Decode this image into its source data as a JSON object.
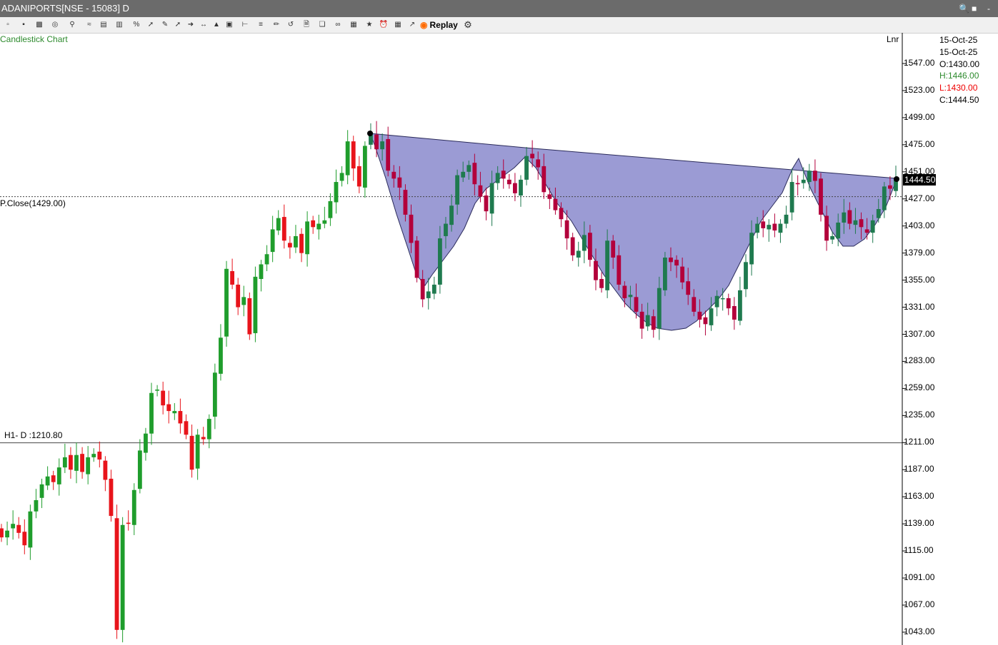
{
  "window": {
    "title": "ADANIPORTS[NSE - 15083] D",
    "controls": [
      "-"
    ]
  },
  "toolbar": {
    "replay_label": "Replay"
  },
  "chart": {
    "title": "Candlestick Chart",
    "scale_mode": "Lnr",
    "info": {
      "date1": "15-Oct-25",
      "date2": "15-Oct-25",
      "open": "O:1430.00",
      "high": "H:1446.00",
      "low": "L:1430.00",
      "close": "C:1444.50"
    },
    "prev_close_label": "P.Close(1429.00)",
    "h1_label": "H1- D :1210.80",
    "last_price_label": "1444.50",
    "colors": {
      "up": "#1f9d2c",
      "down": "#e8141b",
      "down_in_pattern": "#b3003b",
      "up_in_pattern": "#1f7a4f",
      "pattern_fill": "#9b9bd4",
      "axis": "#000000"
    }
  },
  "chart_data": {
    "type": "candlestick",
    "y_ticks": [
      1547,
      1523,
      1499,
      1475,
      1451,
      1427,
      1403,
      1379,
      1355,
      1331,
      1307,
      1283,
      1259,
      1235,
      1211,
      1187,
      1163,
      1139,
      1115,
      1091,
      1067,
      1043
    ],
    "y_tick_labels": [
      "1547.00",
      "1523.00",
      "1499.00",
      "1475.00",
      "1451.00",
      "1427.00",
      "1403.00",
      "1379.00",
      "1355.00",
      "1331.00",
      "1307.00",
      "1283.00",
      "1259.00",
      "1235.00",
      "1211.00",
      "1187.00",
      "1163.00",
      "1139.00",
      "1115.00",
      "1091.00",
      "1067.00",
      "1043.00"
    ],
    "ylim": [
      1027,
      1572
    ],
    "reference_lines": {
      "prev_close": 1429.0,
      "h1": 1210.8
    },
    "last_close": 1444.5,
    "closes": [
      1127,
      1133,
      1139,
      1131,
      1120,
      1150,
      1160,
      1174,
      1181,
      1176,
      1189,
      1198,
      1187,
      1200,
      1185,
      1198,
      1201,
      1196,
      1178,
      1146,
      1045,
      1138,
      1139,
      1169,
      1204,
      1219,
      1255,
      1258,
      1244,
      1239,
      1239,
      1228,
      1218,
      1187,
      1218,
      1214,
      1232,
      1273,
      1304,
      1365,
      1351,
      1331,
      1340,
      1307,
      1358,
      1369,
      1378,
      1400,
      1410,
      1390,
      1384,
      1394,
      1379,
      1407,
      1402,
      1405,
      1408,
      1425,
      1442,
      1450,
      1478,
      1454,
      1438,
      1474,
      1486,
      1471,
      1478,
      1452,
      1445,
      1437,
      1413,
      1388,
      1357,
      1338,
      1345,
      1351,
      1392,
      1405,
      1421,
      1448,
      1451,
      1457,
      1440,
      1429,
      1416,
      1441,
      1450,
      1445,
      1440,
      1432,
      1444,
      1465,
      1463,
      1455,
      1433,
      1427,
      1417,
      1409,
      1392,
      1377,
      1381,
      1395,
      1373,
      1355,
      1348,
      1390,
      1375,
      1351,
      1339,
      1342,
      1327,
      1312,
      1324,
      1311,
      1348,
      1375,
      1371,
      1368,
      1353,
      1342,
      1327,
      1320,
      1316,
      1330,
      1341,
      1339,
      1330,
      1320,
      1346,
      1371,
      1397,
      1405,
      1401,
      1404,
      1399,
      1405,
      1413,
      1442,
      1440,
      1444,
      1452,
      1443,
      1413,
      1390,
      1394,
      1406,
      1415,
      1405,
      1408,
      1402,
      1397,
      1408,
      1418,
      1438,
      1436,
      1444.5
    ]
  }
}
